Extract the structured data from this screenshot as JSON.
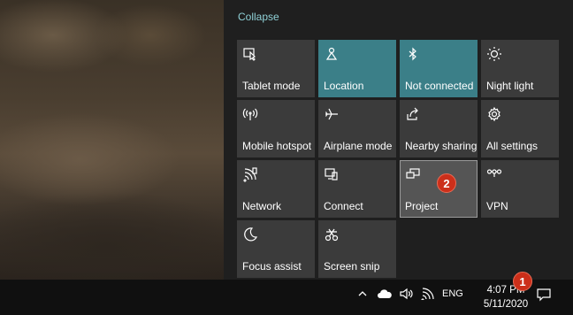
{
  "action_center": {
    "collapse_label": "Collapse",
    "accent_color": "#3b7f88",
    "tiles": [
      {
        "label": "Tablet mode",
        "icon": "tablet-mode-icon",
        "active": false
      },
      {
        "label": "Location",
        "icon": "location-icon",
        "active": true
      },
      {
        "label": "Not connected",
        "icon": "bluetooth-icon",
        "active": true
      },
      {
        "label": "Night light",
        "icon": "night-light-icon",
        "active": false
      },
      {
        "label": "Mobile hotspot",
        "icon": "mobile-hotspot-icon",
        "active": false
      },
      {
        "label": "Airplane mode",
        "icon": "airplane-icon",
        "active": false
      },
      {
        "label": "Nearby sharing",
        "icon": "nearby-sharing-icon",
        "active": false
      },
      {
        "label": "All settings",
        "icon": "gear-icon",
        "active": false
      },
      {
        "label": "Network",
        "icon": "network-icon",
        "active": false
      },
      {
        "label": "Connect",
        "icon": "connect-icon",
        "active": false
      },
      {
        "label": "Project",
        "icon": "project-icon",
        "active": false
      },
      {
        "label": "VPN",
        "icon": "vpn-icon",
        "active": false
      },
      {
        "label": "Focus assist",
        "icon": "moon-icon",
        "active": false
      },
      {
        "label": "Screen snip",
        "icon": "screen-snip-icon",
        "active": false
      }
    ]
  },
  "taskbar": {
    "language": "ENG",
    "time": "4:07 PM",
    "date": "5/11/2020"
  },
  "annotations": {
    "badge_1": "1",
    "badge_2": "2",
    "badge_color": "#cc2f1a"
  }
}
